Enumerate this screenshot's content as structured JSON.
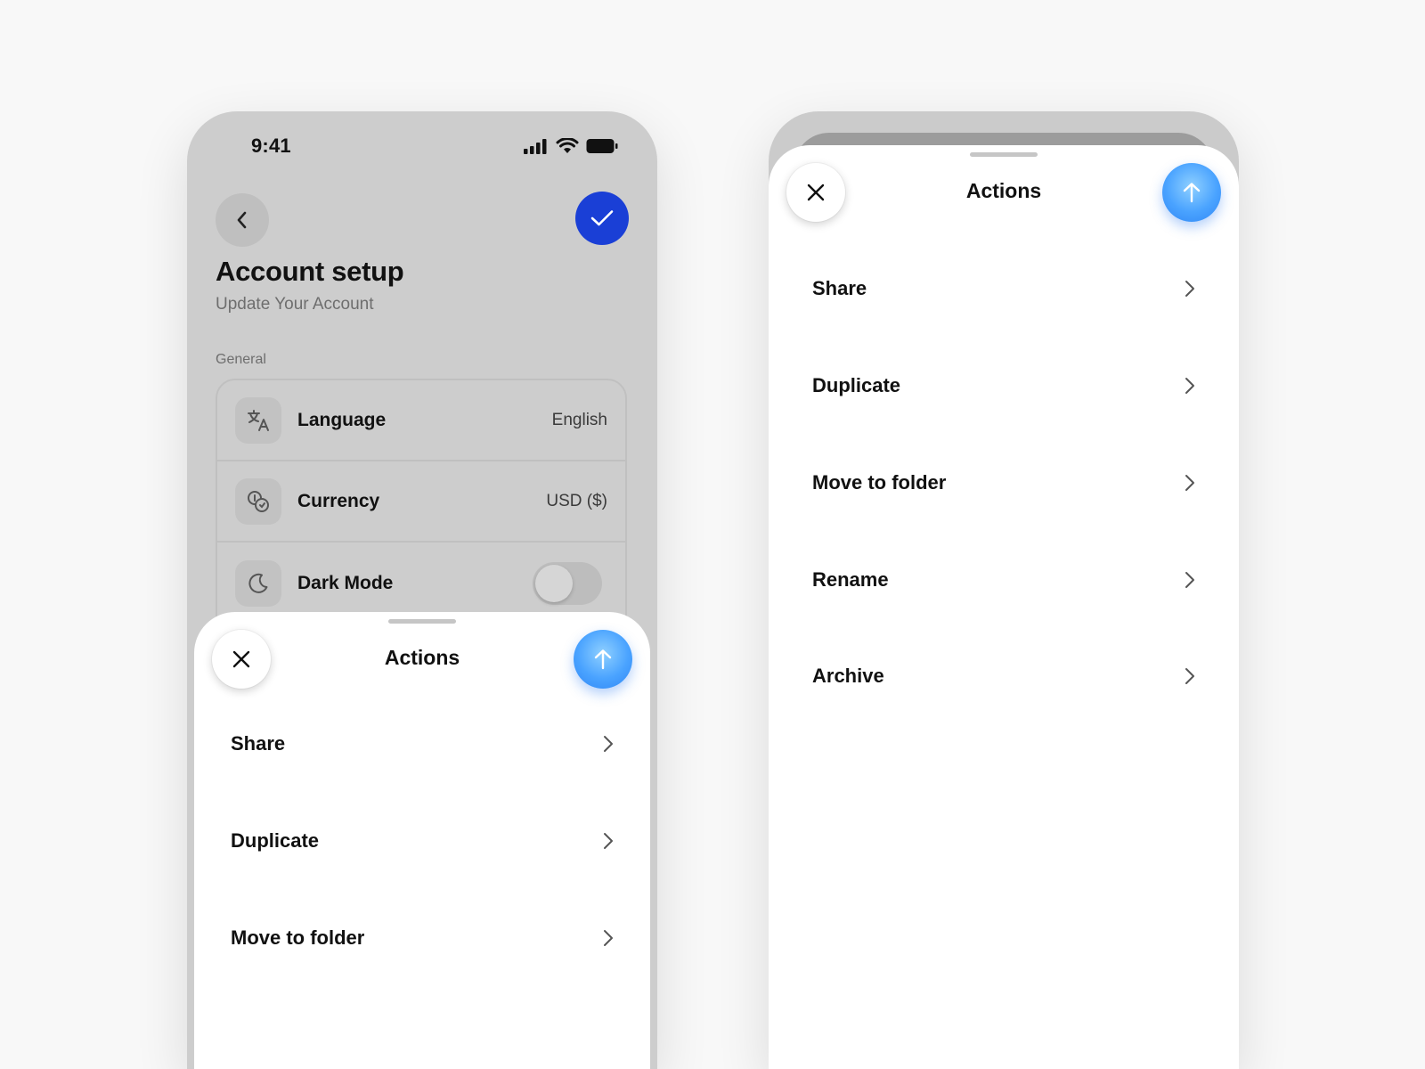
{
  "status_bar": {
    "time": "9:41"
  },
  "account_screen": {
    "title": "Account setup",
    "subtitle": "Update Your Account",
    "section_label": "General",
    "settings": [
      {
        "label": "Language",
        "value": "English",
        "icon": "translate-icon"
      },
      {
        "label": "Currency",
        "value": "USD ($)",
        "icon": "coins-icon"
      },
      {
        "label": "Dark Mode",
        "icon": "moon-icon",
        "toggle": false
      }
    ],
    "confirm_color": "#1a3fd6"
  },
  "sheet_left": {
    "title": "Actions",
    "items": [
      "Share",
      "Duplicate",
      "Move to folder"
    ]
  },
  "sheet_right": {
    "title": "Actions",
    "items": [
      "Share",
      "Duplicate",
      "Move to folder",
      "Rename",
      "Archive"
    ]
  },
  "colors": {
    "accent_blue": "#4aa3ff",
    "page_background": "#f8f8f8"
  }
}
